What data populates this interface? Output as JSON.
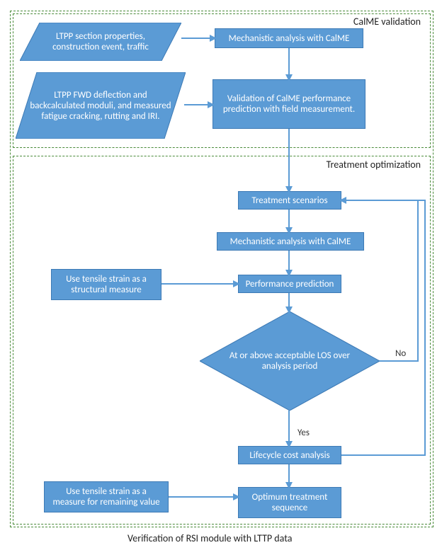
{
  "sections": {
    "validation_label": "CalME validation",
    "optimization_label": "Treatment optimization"
  },
  "nodes": {
    "ltpp_props": "LTPP section properties, construction event, traffic",
    "mech1": "Mechanistic analysis with CalME",
    "ltpp_fwd": "LTPP FWD deflection and backcalculated moduli, and measured fatigue cracking, rutting and IRI.",
    "validation": "Validation of CalME performance prediction with field measurement.",
    "treatment_scenarios": "Treatment scenarios",
    "mech2": "Mechanistic analysis with CalME",
    "tensile_structural": "Use tensile strain as a structural measure",
    "perf_prediction": "Performance prediction",
    "decision": "At or above acceptable LOS over analysis period",
    "lifecycle": "Lifecycle cost analysis",
    "tensile_remaining": "Use tensile strain as a measure for remaining value",
    "optimum": "Optimum treatment sequence"
  },
  "edges": {
    "no": "No",
    "yes": "Yes"
  },
  "caption": "Verification of RSI module with LTTP data",
  "colors": {
    "fill": "#5b9bd5",
    "border": "#3d7ab5",
    "dash": "#4a8b3a"
  },
  "chart_data": {
    "type": "flowchart",
    "groups": [
      {
        "id": "validation",
        "label": "CalME validation",
        "nodes": [
          "ltpp_props",
          "mech1",
          "ltpp_fwd",
          "validation"
        ]
      },
      {
        "id": "optimization",
        "label": "Treatment optimization",
        "nodes": [
          "treatment_scenarios",
          "mech2",
          "tensile_structural",
          "perf_prediction",
          "decision",
          "lifecycle",
          "tensile_remaining",
          "optimum"
        ]
      }
    ],
    "nodes": [
      {
        "id": "ltpp_props",
        "shape": "parallelogram",
        "text": "LTPP section properties, construction event, traffic"
      },
      {
        "id": "mech1",
        "shape": "rect",
        "text": "Mechanistic analysis with CalME"
      },
      {
        "id": "ltpp_fwd",
        "shape": "parallelogram",
        "text": "LTPP FWD deflection and backcalculated moduli, and measured fatigue cracking, rutting and IRI."
      },
      {
        "id": "validation",
        "shape": "rect",
        "text": "Validation of CalME performance prediction with field measurement."
      },
      {
        "id": "treatment_scenarios",
        "shape": "rect",
        "text": "Treatment scenarios"
      },
      {
        "id": "mech2",
        "shape": "rect",
        "text": "Mechanistic analysis with CalME"
      },
      {
        "id": "tensile_structural",
        "shape": "rect",
        "text": "Use tensile strain as a structural measure"
      },
      {
        "id": "perf_prediction",
        "shape": "rect",
        "text": "Performance prediction"
      },
      {
        "id": "decision",
        "shape": "diamond",
        "text": "At or above acceptable LOS over analysis period"
      },
      {
        "id": "lifecycle",
        "shape": "rect",
        "text": "Lifecycle cost analysis"
      },
      {
        "id": "tensile_remaining",
        "shape": "rect",
        "text": "Use tensile strain as a measure for remaining value"
      },
      {
        "id": "optimum",
        "shape": "rect",
        "text": "Optimum treatment sequence"
      }
    ],
    "edges": [
      {
        "from": "ltpp_props",
        "to": "mech1"
      },
      {
        "from": "mech1",
        "to": "validation"
      },
      {
        "from": "ltpp_fwd",
        "to": "validation"
      },
      {
        "from": "validation",
        "to": "treatment_scenarios"
      },
      {
        "from": "treatment_scenarios",
        "to": "mech2"
      },
      {
        "from": "mech2",
        "to": "perf_prediction"
      },
      {
        "from": "tensile_structural",
        "to": "perf_prediction"
      },
      {
        "from": "perf_prediction",
        "to": "decision"
      },
      {
        "from": "decision",
        "to": "lifecycle",
        "label": "Yes"
      },
      {
        "from": "decision",
        "to": "treatment_scenarios",
        "label": "No"
      },
      {
        "from": "lifecycle",
        "to": "optimum"
      },
      {
        "from": "lifecycle",
        "to": "treatment_scenarios"
      },
      {
        "from": "tensile_remaining",
        "to": "optimum"
      }
    ],
    "caption": "Verification of RSI module with LTTP data"
  }
}
